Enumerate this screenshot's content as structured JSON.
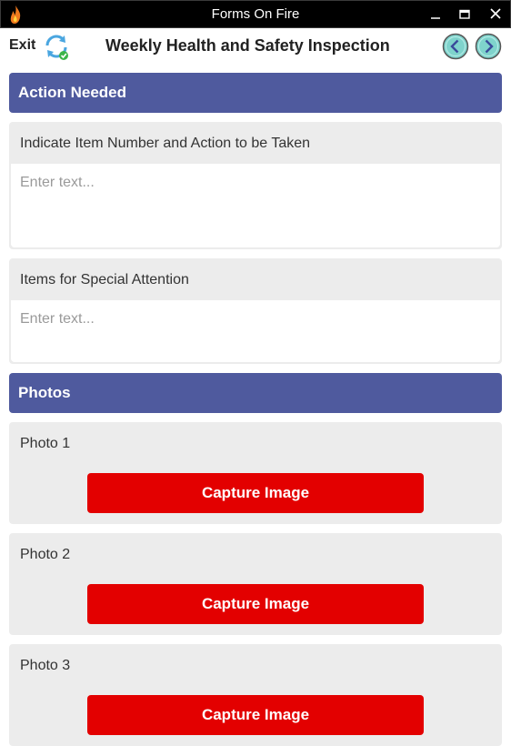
{
  "window": {
    "title": "Forms On Fire",
    "app_icon": "flame-icon",
    "controls": [
      "minimize-icon",
      "maximize-icon",
      "close-icon"
    ]
  },
  "header": {
    "exit_label": "Exit",
    "sync_icon": "sync-icon",
    "form_title": "Weekly Health and Safety Inspection",
    "prev_icon": "chevron-left-icon",
    "next_icon": "chevron-right-icon"
  },
  "sections": [
    {
      "title": "Action Needed",
      "fields": [
        {
          "label": "Indicate Item Number and Action to be Taken",
          "placeholder": "Enter text...",
          "value": ""
        },
        {
          "label": "Items for Special Attention",
          "placeholder": "Enter text...",
          "value": ""
        }
      ]
    },
    {
      "title": "Photos",
      "photos": [
        {
          "label": "Photo 1",
          "button_label": "Capture Image"
        },
        {
          "label": "Photo 2",
          "button_label": "Capture Image"
        },
        {
          "label": "Photo 3",
          "button_label": "Capture Image"
        }
      ]
    }
  ],
  "colors": {
    "section_header": "#4f5a9e",
    "capture_button": "#e30000",
    "card_background": "#ececec",
    "nav_button": "#7fd3cc"
  }
}
